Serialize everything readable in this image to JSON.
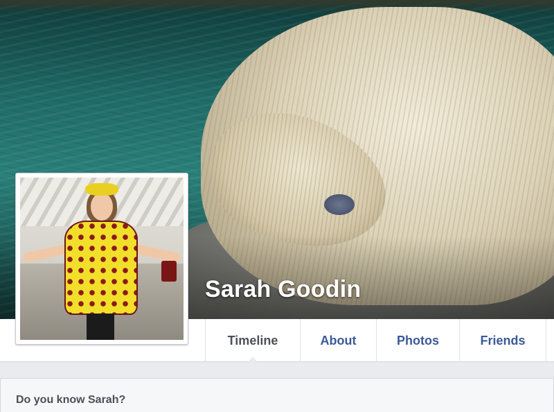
{
  "profile": {
    "name": "Sarah Goodin"
  },
  "tabs": [
    {
      "label": "Timeline",
      "active": true
    },
    {
      "label": "About"
    },
    {
      "label": "Photos"
    },
    {
      "label": "Friends"
    }
  ],
  "suggestion": {
    "title": "Do you know Sarah?"
  },
  "colors": {
    "link_blue": "#3b5998",
    "active_tab_text": "#4b4f56",
    "page_background": "#e9ebee"
  }
}
